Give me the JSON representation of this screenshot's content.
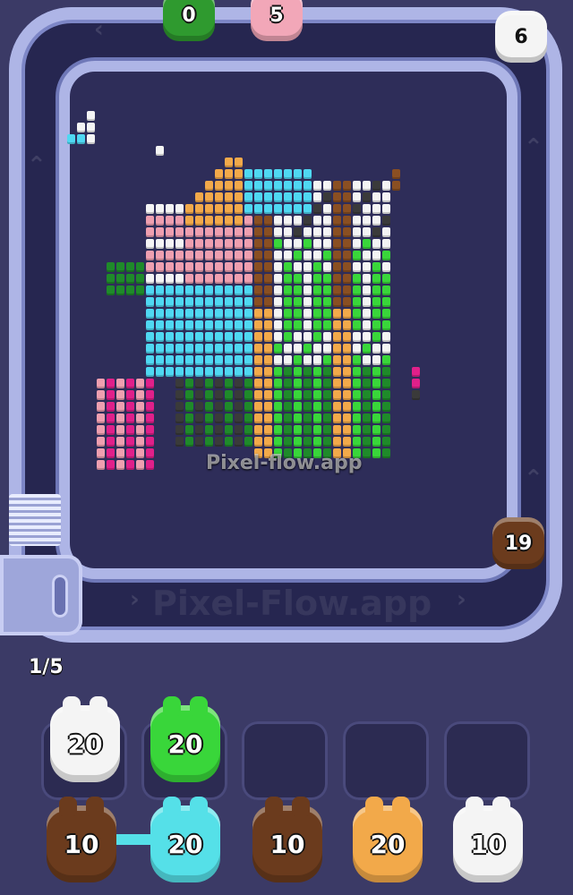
{
  "watermark": {
    "board": "Pixel-flow.app",
    "track_bottom": "Pixel-Flow.app"
  },
  "launcher": {
    "progress": "1/5"
  },
  "track_pigs": [
    {
      "color": "#2f9a2f",
      "count": "0"
    },
    {
      "color": "#f2a7b8",
      "count": "5"
    },
    {
      "color": "#f4f4f4",
      "count": "6"
    },
    {
      "color": "#6b3b1d",
      "count": "19"
    }
  ],
  "holding_slots": [
    {
      "color": "#f4f4f4",
      "count": "20"
    },
    {
      "color": "#39d63a",
      "count": "20"
    },
    {
      "color": "",
      "count": ""
    },
    {
      "color": "",
      "count": ""
    },
    {
      "color": "",
      "count": ""
    }
  ],
  "queue": [
    {
      "color": "#6b3b1d",
      "count": "10"
    },
    {
      "color": "#55e0e8",
      "count": "20"
    },
    {
      "color": "#6b3b1d",
      "count": "10"
    },
    {
      "color": "#f2a94a",
      "count": "20"
    },
    {
      "color": "#f4f4f4",
      "count": "10"
    }
  ],
  "palette": {
    "orange": "#f2a94a",
    "cyan": "#4fd8f2",
    "pink": "#ef9fb0",
    "white": "#f4f4f4",
    "green": "#39d63a",
    "darkgreen": "#1f8a2a",
    "brown": "#8a4f22",
    "black": "#3a3a3a",
    "magenta": "#e0208a"
  }
}
